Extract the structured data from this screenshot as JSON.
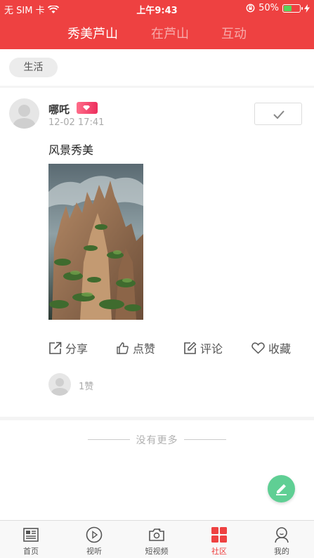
{
  "status_bar": {
    "carrier": "无 SIM 卡",
    "time": "上午9:43",
    "battery": "50%",
    "battery_level": 0.5
  },
  "header": {
    "tabs": [
      {
        "label": "秀美芦山",
        "active": true
      },
      {
        "label": "在芦山",
        "active": false
      },
      {
        "label": "互动",
        "active": false
      }
    ]
  },
  "filter": {
    "chip_label": "生活"
  },
  "post": {
    "author": "哪吒",
    "timestamp": "12-02 17:41",
    "text": "风景秀美",
    "photo_icon": "mountain-landscape-photo",
    "actions": [
      {
        "label": "分享",
        "icon": "share-icon"
      },
      {
        "label": "点赞",
        "icon": "thumbs-up-icon"
      },
      {
        "label": "评论",
        "icon": "comment-edit-icon"
      },
      {
        "label": "收藏",
        "icon": "heart-icon"
      }
    ],
    "like_count": "1赞"
  },
  "feed_end_text": "没有更多",
  "bottom_nav": [
    {
      "label": "首页",
      "icon": "newspaper-icon",
      "active": false
    },
    {
      "label": "视听",
      "icon": "play-circle-icon",
      "active": false
    },
    {
      "label": "短视频",
      "icon": "camera-icon",
      "active": false
    },
    {
      "label": "社区",
      "icon": "grid-icon",
      "active": true
    },
    {
      "label": "我的",
      "icon": "user-icon",
      "active": false
    }
  ],
  "colors": {
    "brand_red": "#ee4141",
    "fab_green": "#5fcf94",
    "badge_pink": "#ec2f5d"
  }
}
